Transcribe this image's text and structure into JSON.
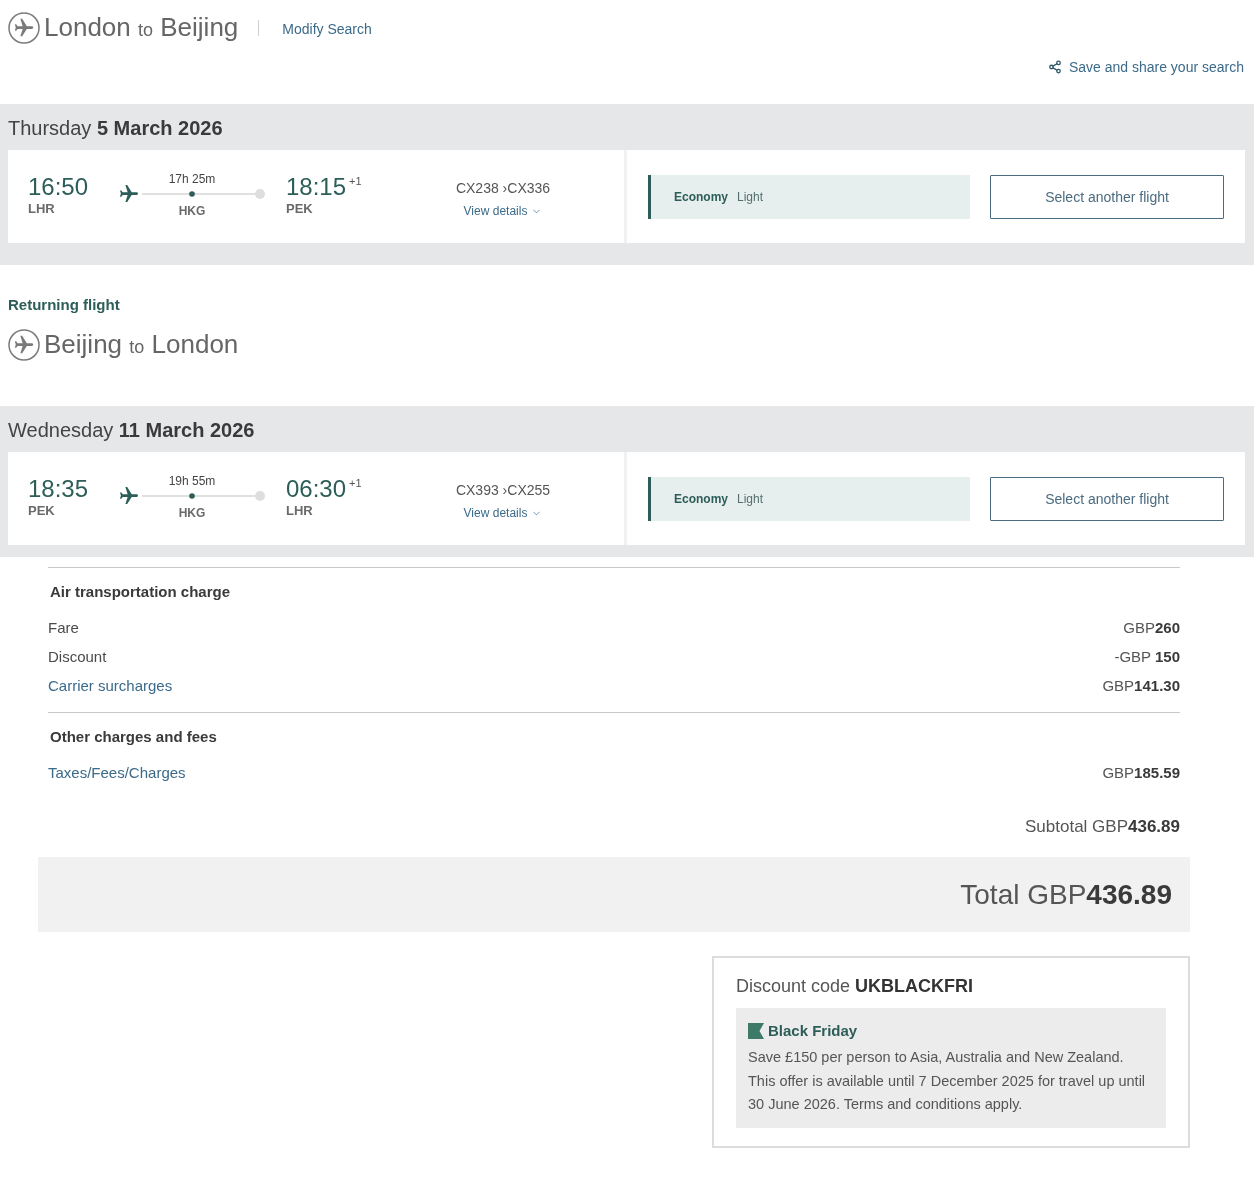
{
  "header": {
    "route": {
      "from": "London",
      "connector": "to",
      "to": "Beijing"
    },
    "modify_link": "Modify Search",
    "share_link": "Save and share your search"
  },
  "outbound": {
    "date": "Thursday **5 March 2026**",
    "flight": {
      "departure": {
        "time": "16:50",
        "airport": "LHR"
      },
      "duration": "17h 25m",
      "stop": "HKG",
      "arrival": {
        "time": "18:15",
        "day_offset": "+1",
        "airport": "PEK"
      },
      "flight_numbers": "CX238 ›CX336",
      "details_link": "View details",
      "cabin": "Economy",
      "fare": "Light",
      "select_button": "Select another flight"
    }
  },
  "returning": {
    "label": "Returning flight",
    "route": {
      "from": "Beijing",
      "connector": "to",
      "to": "London"
    },
    "date": "Wednesday **11 March 2026**",
    "flight": {
      "departure": {
        "time": "18:35",
        "airport": "PEK"
      },
      "duration": "19h 55m",
      "stop": "HKG",
      "arrival": {
        "time": "06:30",
        "day_offset": "+1",
        "airport": "LHR"
      },
      "flight_numbers": "CX393 ›CX255",
      "details_link": "View details",
      "cabin": "Economy",
      "fare": "Light",
      "select_button": "Select another flight"
    }
  },
  "charges": {
    "groups": [
      {
        "heading": "Air transportation charge",
        "rows": [
          {
            "kind": "plain",
            "label": "Fare",
            "amount": "GBP**260**"
          },
          {
            "kind": "plain",
            "label": "Discount",
            "amount": "-GBP **150**"
          },
          {
            "kind": "link",
            "label": "Carrier surcharges",
            "amount": "GBP**141.30**"
          }
        ]
      },
      {
        "heading": "Other charges and fees",
        "rows": [
          {
            "kind": "link",
            "label": "Taxes/Fees/Charges",
            "amount": "GBP**185.59**"
          }
        ]
      }
    ],
    "subtotal": "Subtotal GBP**436.89**",
    "total": "Total GBP**436.89**"
  },
  "discount": {
    "heading": "Discount code **UKBLACKFRI**",
    "promo": {
      "title": "Black Friday",
      "text": "Save £150 per person to Asia, Australia and New Zealand. This offer is available until 7 December 2025 for travel up until 30 June 2026. Terms and conditions apply."
    }
  }
}
